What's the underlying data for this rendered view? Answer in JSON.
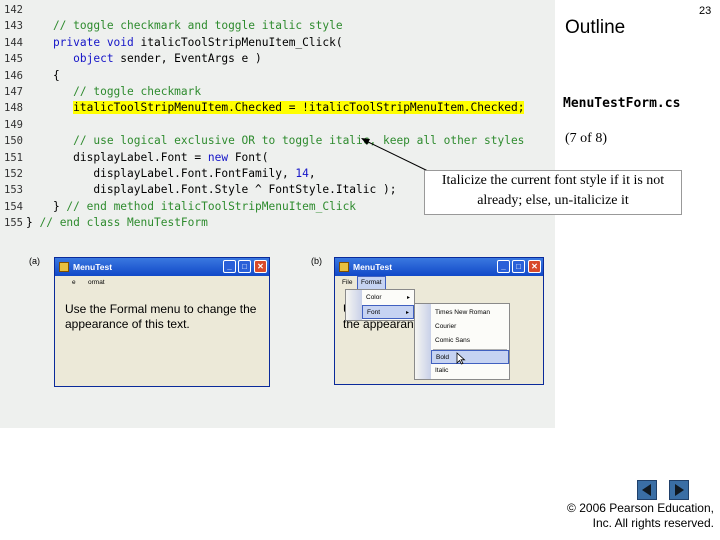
{
  "header": {
    "outline_label": "Outline",
    "page_number": "23",
    "file_name": "MenuTestForm.cs",
    "page_of": "(7 of 8)"
  },
  "code_lines": [
    {
      "num": "142",
      "segments": []
    },
    {
      "num": "143",
      "segments": [
        {
          "t": "    // toggle checkmark and toggle italic style",
          "c": "comment"
        }
      ]
    },
    {
      "num": "144",
      "segments": [
        {
          "t": "    private void ",
          "c": "kw"
        },
        {
          "t": "italicToolStripMenuItem_Click(",
          "c": "plain"
        }
      ]
    },
    {
      "num": "145",
      "segments": [
        {
          "t": "       object ",
          "c": "kw"
        },
        {
          "t": "sender, EventArgs e )",
          "c": "plain"
        }
      ]
    },
    {
      "num": "146",
      "segments": [
        {
          "t": "    {",
          "c": "plain"
        }
      ]
    },
    {
      "num": "147",
      "segments": [
        {
          "t": "       // toggle checkmark",
          "c": "comment"
        }
      ]
    },
    {
      "num": "148",
      "segments": [
        {
          "t": "       ",
          "c": "plain"
        },
        {
          "t": "italicToolStripMenuItem.Checked = !italicToolStripMenuItem.Checked;",
          "c": "plain",
          "hl": true
        }
      ]
    },
    {
      "num": "149",
      "segments": []
    },
    {
      "num": "150",
      "segments": [
        {
          "t": "       // use logical exclusive OR to toggle italic, keep all other styles",
          "c": "comment"
        }
      ]
    },
    {
      "num": "151",
      "segments": [
        {
          "t": "       displayLabel.Font = ",
          "c": "plain"
        },
        {
          "t": "new ",
          "c": "kw"
        },
        {
          "t": "Font(",
          "c": "plain"
        }
      ]
    },
    {
      "num": "152",
      "segments": [
        {
          "t": "          displayLabel.Font.FontFamily, ",
          "c": "plain"
        },
        {
          "t": "14",
          "c": "num"
        },
        {
          "t": ",",
          "c": "plain"
        }
      ]
    },
    {
      "num": "153",
      "segments": [
        {
          "t": "          displayLabel.Font.Style ^ FontStyle.Italic );",
          "c": "plain"
        }
      ]
    },
    {
      "num": "154",
      "segments": [
        {
          "t": "    } ",
          "c": "plain"
        },
        {
          "t": "// end method italicToolStripMenuItem_Click",
          "c": "comment"
        }
      ]
    },
    {
      "num": "155",
      "segments": [
        {
          "t": "} ",
          "c": "plain"
        },
        {
          "t": "// end class MenuTestForm",
          "c": "comment"
        }
      ]
    }
  ],
  "callout_text": "Italicize the current font style if it is not already; else, un-italicize it",
  "screenshots": {
    "a": {
      "label": "(a)",
      "title": "MenuTest",
      "menu": [
        "e",
        "ormat"
      ],
      "body_text": "Use the Formal menu to change the appearance of this text."
    },
    "b": {
      "label": "(b)",
      "title": "MenuTest",
      "menu": [
        "File",
        "Format"
      ],
      "body_text_line1": "Us",
      "body_text_line1_end": "e",
      "body_text_line2": "the appearan",
      "format_menu": [
        {
          "label": "Color",
          "arrow": "▸"
        },
        {
          "label": "Font",
          "arrow": "▸"
        }
      ],
      "font_menu": [
        "Times New Roman",
        "Courier",
        "Comic Sans",
        "Bold",
        "Italic"
      ],
      "selected_font_item": "Bold"
    }
  },
  "copyright": {
    "line1": "© 2006 Pearson Education,",
    "line2": "Inc.  All rights reserved."
  },
  "colors": {
    "comment": "#2e8b2e",
    "keyword": "#1515c8",
    "highlight": "#ffff00",
    "nav_button": "#3a6ea5"
  },
  "icons": {
    "prev": "triangle-left-icon",
    "next": "triangle-right-icon"
  }
}
